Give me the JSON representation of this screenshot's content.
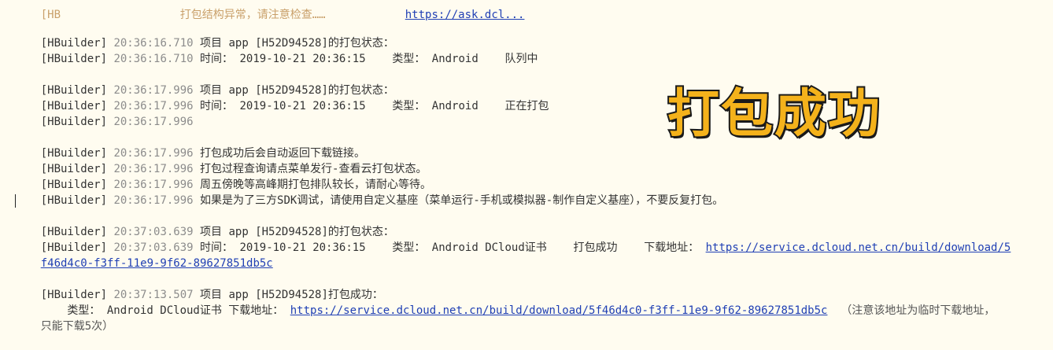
{
  "header_fragment": {
    "left": "[HB",
    "mid": "打包结构异常，请注意检查……",
    "link": "https://ask.dcl..."
  },
  "banner": "打包成功",
  "log": [
    {
      "tag": "[HBuilder]",
      "time": "20:36:16.710",
      "msg": "项目 app [H52D94528]的打包状态："
    },
    {
      "tag": "[HBuilder]",
      "time": "20:36:16.710",
      "msg": "时间： 2019-10-21 20:36:15    类型： Android    队列中"
    },
    {
      "tag": "[HBuilder]",
      "time": "20:36:17.996",
      "msg": "项目 app [H52D94528]的打包状态："
    },
    {
      "tag": "[HBuilder]",
      "time": "20:36:17.996",
      "msg": "时间： 2019-10-21 20:36:15    类型： Android    正在打包"
    },
    {
      "tag": "[HBuilder]",
      "time": "20:36:17.996",
      "msg": ""
    },
    {
      "tag": "[HBuilder]",
      "time": "20:36:17.996",
      "msg": "打包成功后会自动返回下载链接。"
    },
    {
      "tag": "[HBuilder]",
      "time": "20:36:17.996",
      "msg": "打包过程查询请点菜单发行-查看云打包状态。"
    },
    {
      "tag": "[HBuilder]",
      "time": "20:36:17.996",
      "msg": "周五傍晚等高峰期打包排队较长，请耐心等待。"
    },
    {
      "tag": "[HBuilder]",
      "time": "20:36:17.996",
      "msg": "如果是为了三方SDK调试，请使用自定义基座（菜单运行-手机或模拟器-制作自定义基座），不要反复打包。"
    },
    {
      "tag": "[HBuilder]",
      "time": "20:37:03.639",
      "msg": "项目 app [H52D94528]的打包状态："
    },
    {
      "tag": "[HBuilder]",
      "time": "20:37:03.639",
      "msg": "时间： 2019-10-21 20:36:15    类型： Android DCloud证书    打包成功    下载地址： "
    },
    {
      "tag": "[HBuilder]",
      "time": "20:37:13.507",
      "msg": "项目 app [H52D94528]打包成功："
    }
  ],
  "download_url_part1": "https://service.dcloud.net.cn/build/download/5",
  "download_url_part2": "f46d4c0-f3ff-11e9-9f62-89627851db5c",
  "final_detail": {
    "prefix": "    类型： Android DCloud证书 下载地址： ",
    "url": "https://service.dcloud.net.cn/build/download/5f46d4c0-f3ff-11e9-9f62-89627851db5c",
    "note1": "  （注意该地址为临时下载地址，",
    "note2": "只能下载5次）"
  }
}
